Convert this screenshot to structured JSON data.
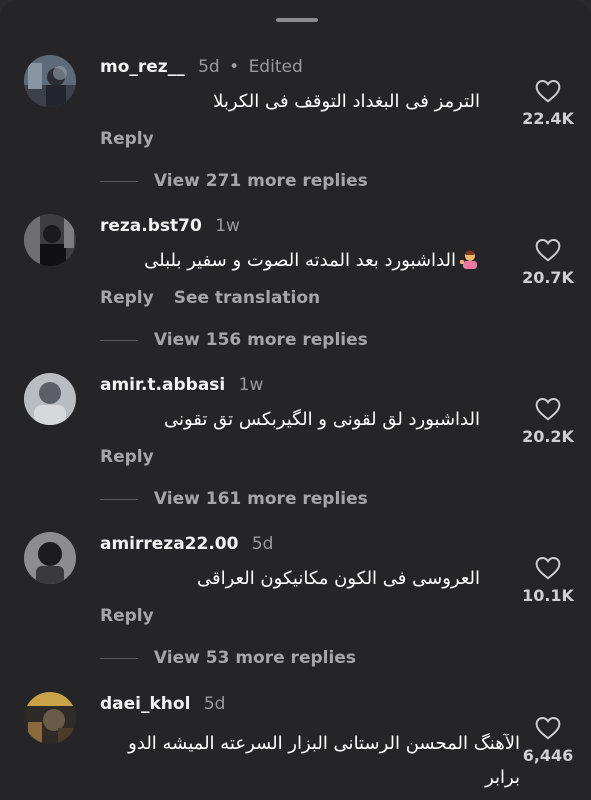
{
  "comments": [
    {
      "username": "mo_rez__",
      "time": "5d",
      "edited": "Edited",
      "text": "الترمز فی البغداد التوقف فی الکربلا",
      "reply": "Reply",
      "likes": "22.4K",
      "view_replies": "View 271 more replies"
    },
    {
      "username": "reza.bst70",
      "time": "1w",
      "text": "الداشبورد بعد المدته الصوت و سفیر بلبلی",
      "reply": "Reply",
      "translation": "See translation",
      "likes": "20.7K",
      "view_replies": "View 156 more replies"
    },
    {
      "username": "amir.t.abbasi",
      "time": "1w",
      "text": "الداشبورد لق لقونی و الگیربکس تق تقونی",
      "reply": "Reply",
      "likes": "20.2K",
      "view_replies": "View 161 more replies"
    },
    {
      "username": "amirreza22.00",
      "time": "5d",
      "text": "العروسی فی الکون مکانیکون العراقی",
      "reply": "Reply",
      "likes": "10.1K",
      "view_replies": "View 53 more replies"
    },
    {
      "username": "daei_khol",
      "time": "5d",
      "text": "الآهنگ المحسن الرستانی البزار السرعته المیشه الدو برابر",
      "likes": "6,446"
    }
  ]
}
